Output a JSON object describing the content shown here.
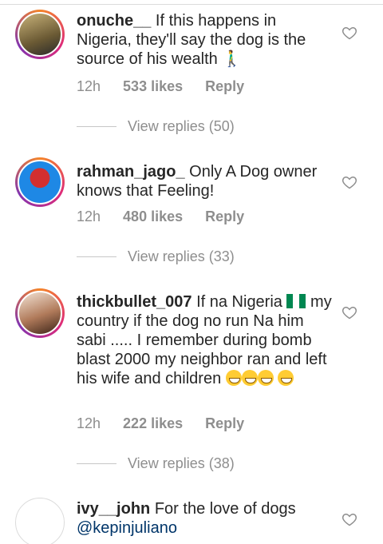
{
  "comments": [
    {
      "username": "onuche__",
      "text": "If this happens in Nigeria, they'll say the dog is the source of his wealth 🚶‍♂️",
      "time": "12h",
      "likes": "533 likes",
      "reply": "Reply",
      "view_replies": "View replies (50)"
    },
    {
      "username": "rahman_jago_",
      "text": "Only A Dog owner knows that Feeling!",
      "time": "12h",
      "likes": "480 likes",
      "reply": "Reply",
      "view_replies": "View replies (33)"
    },
    {
      "username": "thickbullet_007",
      "text_before_flag": "If na Nigeria",
      "text_after_flag": "my country if the dog no run Na him sabi ..... I remember during bomb blast 2000 my neighbor ran and left his wife and children",
      "time": "12h",
      "likes": "222 likes",
      "reply": "Reply",
      "view_replies": "View replies (38)"
    },
    {
      "username": "ivy__john",
      "text": "For the love of dogs",
      "mention": "@kepinjuliano"
    }
  ],
  "icons": {
    "like": "heart-outline-icon",
    "flag": "nigeria-flag-icon",
    "emoji": "grinning-emoji-icon"
  },
  "colors": {
    "text": "#262626",
    "muted": "#8e8e8e",
    "mention": "#003569"
  }
}
